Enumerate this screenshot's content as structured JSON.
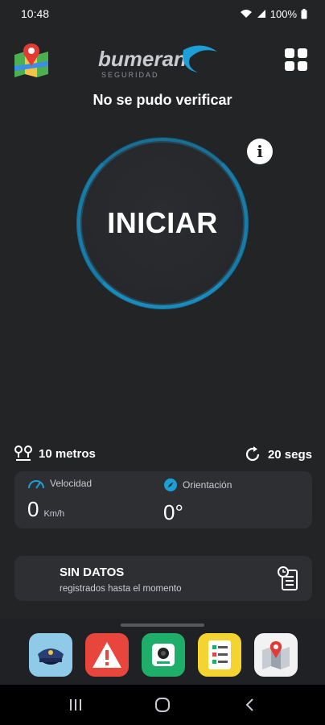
{
  "status_bar": {
    "time": "10:48",
    "battery": "100%"
  },
  "header": {
    "logo_text": "bumeran",
    "logo_sub": "SEGURIDAD"
  },
  "main": {
    "verify_status": "No se pudo verificar",
    "start_label": "INICIAR",
    "info_glyph": "i",
    "distance": "10 metros",
    "interval": "20 segs",
    "speed": {
      "label": "Velocidad",
      "value": "0",
      "unit": "Km/h"
    },
    "orientation": {
      "label": "Orientación",
      "value": "0°"
    },
    "no_data": {
      "title": "SIN DATOS",
      "subtitle": "registrados hasta el momento"
    }
  },
  "dock": {
    "apps": [
      {
        "icon": "police-cap-icon",
        "color": "#8fcbe8"
      },
      {
        "icon": "warning-icon",
        "color": "#e8463c"
      },
      {
        "icon": "camera-icon",
        "color": "#1fae6a"
      },
      {
        "icon": "checklist-icon",
        "color": "#f5d331"
      },
      {
        "icon": "map-pin-icon",
        "color": "#f2f2f2"
      }
    ]
  },
  "colors": {
    "accent": "#1c9fd6",
    "background": "#232426",
    "card": "#2d2f33"
  }
}
